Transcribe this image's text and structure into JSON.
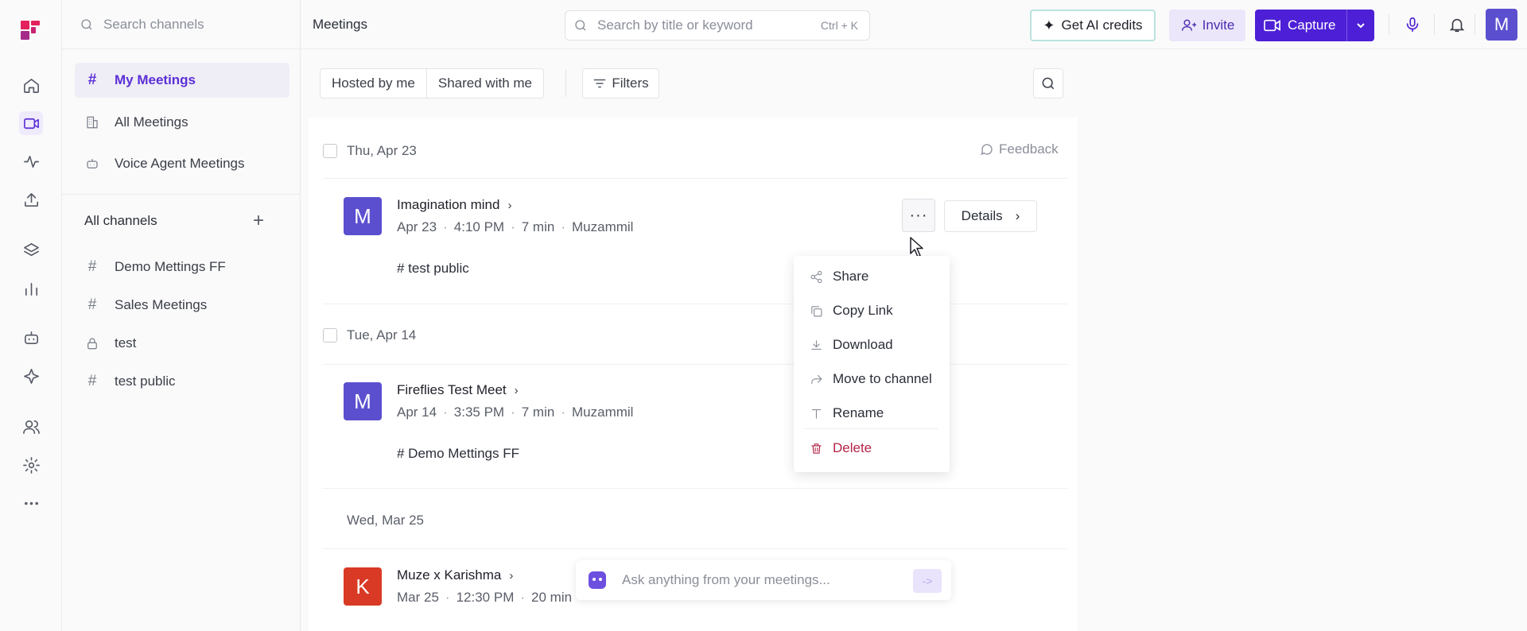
{
  "sidebar": {
    "search_placeholder": "Search channels",
    "items": [
      {
        "label": "My Meetings",
        "icon": "hash-icon"
      },
      {
        "label": "All Meetings",
        "icon": "building-icon"
      },
      {
        "label": "Voice Agent Meetings",
        "icon": "bot-icon"
      }
    ],
    "all_channels_label": "All channels",
    "channels": [
      {
        "label": "Demo Mettings FF",
        "icon": "hash-icon"
      },
      {
        "label": "Sales Meetings",
        "icon": "hash-icon"
      },
      {
        "label": "test",
        "icon": "lock-icon"
      },
      {
        "label": "test public",
        "icon": "hash-icon"
      }
    ]
  },
  "header": {
    "title": "Meetings",
    "search_placeholder": "Search by title or keyword",
    "shortcut": "Ctrl + K",
    "ai_credits_label": "Get AI credits",
    "invite_label": "Invite",
    "capture_label": "Capture",
    "avatar_initial": "M"
  },
  "filters": {
    "hosted_label": "Hosted by me",
    "shared_label": "Shared with me",
    "filters_label": "Filters"
  },
  "list": {
    "feedback_label": "Feedback",
    "groups": [
      {
        "date": "Thu, Apr 23",
        "meeting": {
          "initial": "M",
          "title": "Imagination mind",
          "date": "Apr 23",
          "time": "4:10 PM",
          "duration": "7 min",
          "host": "Muzammil",
          "channel": "# test public"
        }
      },
      {
        "date": "Tue, Apr 14",
        "meeting": {
          "initial": "M",
          "title": "Fireflies Test Meet",
          "date": "Apr 14",
          "time": "3:35 PM",
          "duration": "7 min",
          "host": "Muzammil",
          "channel": "# Demo Mettings FF"
        }
      },
      {
        "date": "Wed, Mar 25",
        "meeting": {
          "initial": "K",
          "title": "Muze x Karishma",
          "date": "Mar 25",
          "time": "12:30 PM",
          "duration": "20 min"
        }
      }
    ],
    "more_label": "···",
    "details_label": "Details"
  },
  "context_menu": {
    "items": [
      {
        "label": "Share",
        "icon": "share-icon"
      },
      {
        "label": "Copy Link",
        "icon": "copy-icon"
      },
      {
        "label": "Download",
        "icon": "download-icon"
      },
      {
        "label": "Move to channel",
        "icon": "forward-arrow-icon"
      },
      {
        "label": "Rename",
        "icon": "text-icon"
      },
      {
        "label": "Delete",
        "icon": "trash-icon"
      }
    ]
  },
  "ask": {
    "placeholder": "Ask anything from your meetings...",
    "send_label": "->"
  },
  "colors": {
    "accent": "#4d1fd6",
    "avatar_m": "#5b4fcf",
    "avatar_k": "#d93a25",
    "danger": "#b42346"
  }
}
